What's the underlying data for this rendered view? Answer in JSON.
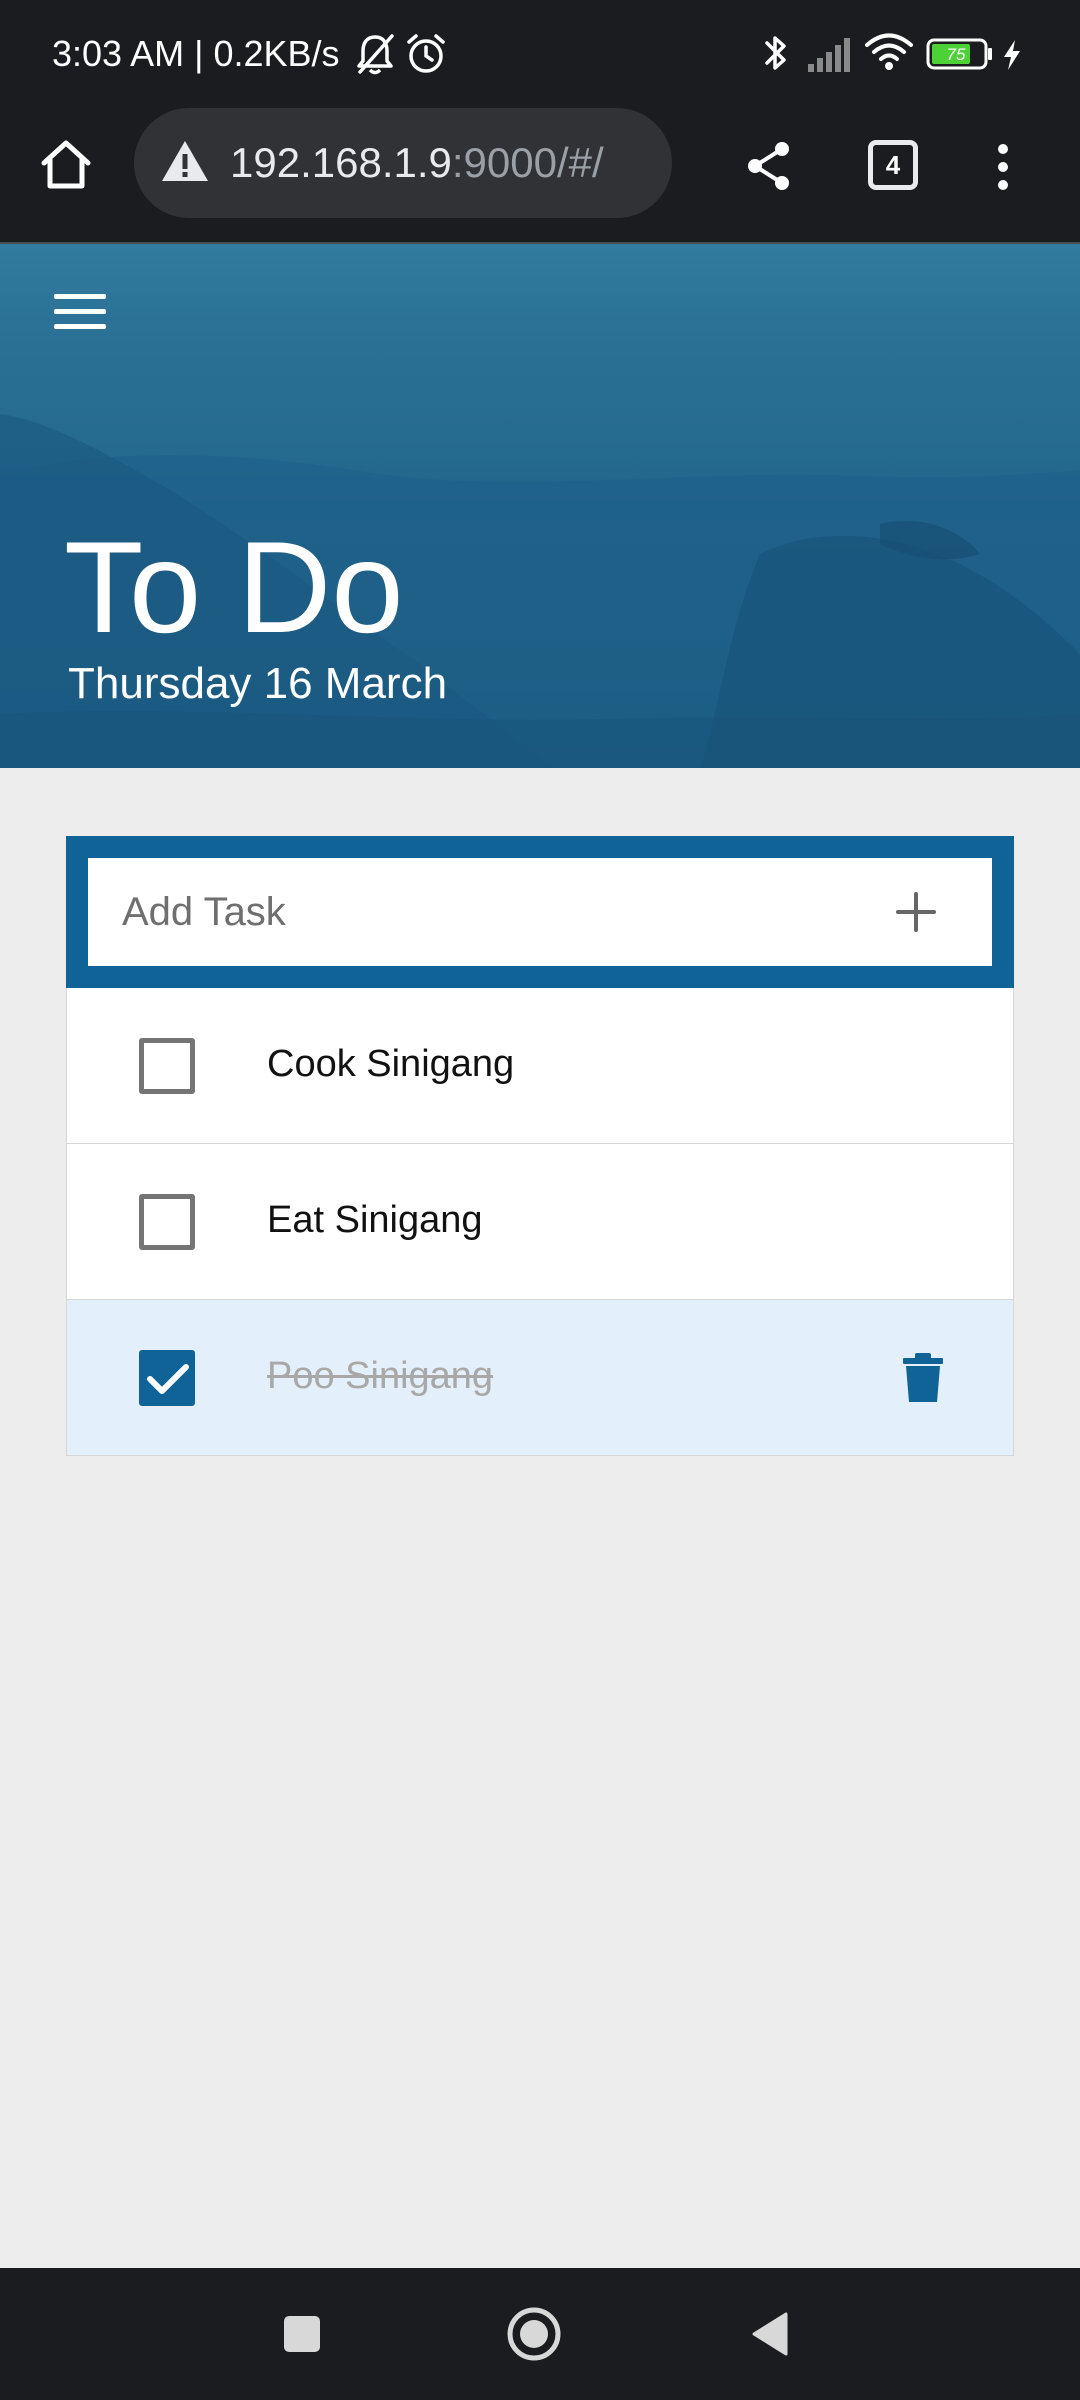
{
  "status_bar": {
    "time_text": "3:03 AM | 0.2KB/s",
    "battery_level": "75",
    "icons": [
      "bell-off-icon",
      "alarm-icon",
      "bluetooth-icon",
      "signal-icon",
      "wifi-icon",
      "battery-icon",
      "charging-icon"
    ]
  },
  "browser": {
    "url_host": "192.168.1.9",
    "url_rest": ":9000/#/",
    "tabs_count": "4",
    "icons": [
      "home-icon",
      "warning-icon",
      "share-icon",
      "tabs-icon",
      "more-icon"
    ]
  },
  "header": {
    "title": "To Do",
    "date": "Thursday 16 March"
  },
  "add_task": {
    "placeholder": "Add Task",
    "value": ""
  },
  "tasks": [
    {
      "label": "Cook Sinigang",
      "done": false
    },
    {
      "label": "Eat Sinigang",
      "done": false
    },
    {
      "label": "Poo Sinigang",
      "done": true
    }
  ],
  "colors": {
    "accent": "#0f6396",
    "done_row_bg": "#e3f0fb",
    "page_bg": "#ededed",
    "system_bar_bg": "#1b1c1f",
    "battery_green": "#4cd137"
  },
  "nav_bar": {
    "icons": [
      "recents-icon",
      "home-circle-icon",
      "back-icon"
    ]
  }
}
